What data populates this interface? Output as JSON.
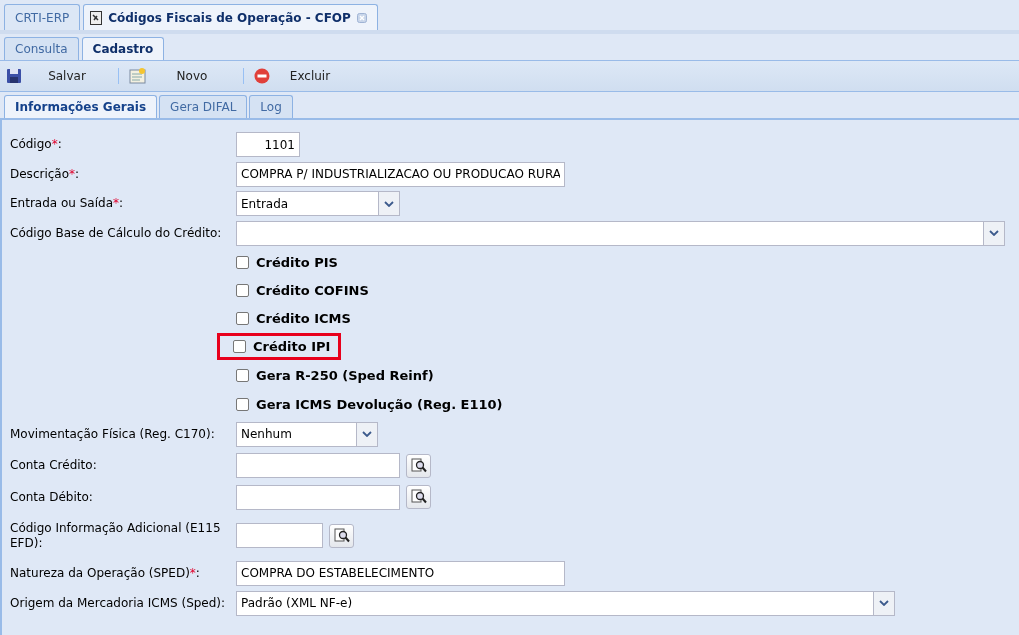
{
  "app_tabs": [
    {
      "label": "CRTI-ERP",
      "selected": false,
      "closable": false
    },
    {
      "label": "Códigos Fiscais de Operação - CFOP",
      "selected": true,
      "closable": true
    }
  ],
  "view_tabs": [
    {
      "label": "Consulta",
      "selected": false
    },
    {
      "label": "Cadastro",
      "selected": true
    }
  ],
  "toolbar": [
    {
      "label": "Salvar",
      "kind": "save"
    },
    {
      "label": "Novo",
      "kind": "new"
    },
    {
      "label": "Excluir",
      "kind": "delete"
    }
  ],
  "form_tabs": [
    {
      "label": "Informações Gerais",
      "selected": true
    },
    {
      "label": "Gera DIFAL",
      "selected": false
    },
    {
      "label": "Log",
      "selected": false
    }
  ],
  "fields": [
    {
      "kind": "number",
      "label": "Código",
      "required_mark": "*",
      "label_end": ":",
      "value": "1101"
    },
    {
      "kind": "text",
      "label": "Descrição",
      "required_mark": "*",
      "label_end": ":",
      "value": "COMPRA P/ INDUSTRIALIZACAO OU PRODUCAO RURA"
    },
    {
      "kind": "select",
      "label": "Entrada ou Saída",
      "required_mark": "*",
      "label_end": ":",
      "value": "Entrada"
    },
    {
      "kind": "select",
      "label": "Código Base de Cálculo do Crédito:"
    },
    {
      "kind": "checkbox",
      "label": "Crédito PIS",
      "checked": false,
      "highlighted": false
    },
    {
      "kind": "checkbox",
      "label": "Crédito COFINS",
      "checked": false,
      "highlighted": false
    },
    {
      "kind": "checkbox",
      "label": "Crédito ICMS",
      "checked": false,
      "highlighted": false
    },
    {
      "kind": "checkbox",
      "label": "Crédito IPI",
      "checked": false,
      "highlighted": true
    },
    {
      "kind": "checkbox",
      "label": "Gera R-250 (Sped Reinf)",
      "checked": false,
      "highlighted": false
    },
    {
      "kind": "checkbox",
      "label": "Gera ICMS Devolução (Reg. E110)",
      "checked": false,
      "highlighted": false
    },
    {
      "kind": "select",
      "label": "Movimentação Física (Reg. C170):",
      "value": "Nenhum"
    },
    {
      "kind": "lookup",
      "label": "Conta Crédito:"
    },
    {
      "kind": "lookup",
      "label": "Conta Débito:"
    },
    {
      "kind": "lookup",
      "label": "Código Informação Adicional (E115 EFD):"
    },
    {
      "kind": "text",
      "label": "Natureza da Operação (SPED)",
      "required_mark": "*",
      "label_end": ":",
      "value": "COMPRA DO ESTABELECIMENTO"
    },
    {
      "kind": "select",
      "label": "Origem da Mercadoria ICMS (Sped):",
      "value": "Padrão (XML NF-e)"
    }
  ]
}
